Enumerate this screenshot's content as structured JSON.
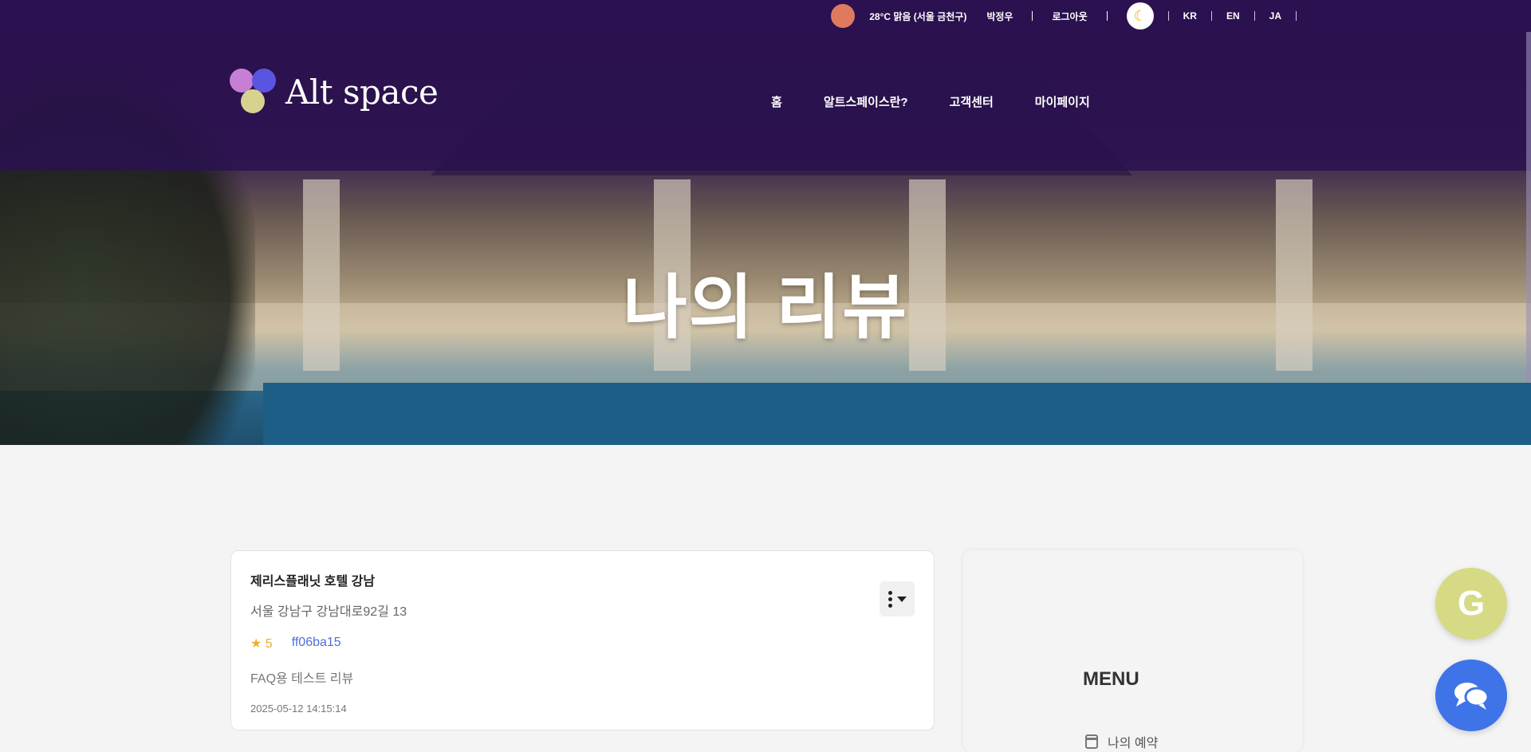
{
  "topbar": {
    "weather": "28°C 맑음 (서울 금천구)",
    "user_name": "박정우",
    "logout": "로그아웃",
    "languages": [
      "KR",
      "EN",
      "JA"
    ]
  },
  "header": {
    "logo_text": "Alt space",
    "nav": [
      "홈",
      "알트스페이스란?",
      "고객센터",
      "마이페이지"
    ]
  },
  "hero": {
    "title": "나의 리뷰"
  },
  "review": {
    "hotel_name": "제리스플래닛 호텔 강남",
    "address": "서울 강남구 강남대로92길 13",
    "rating_star": "★",
    "rating_value": "5",
    "code": "ff06ba15",
    "content": "FAQ용 테스트 리뷰",
    "date": "2025-05-12 14:15:14"
  },
  "side_menu": {
    "title": "MENU",
    "items": [
      "나의 예약"
    ]
  },
  "fab": {
    "g_label": "G"
  },
  "colors": {
    "topbar_bg": "#2b1150",
    "rating": "#f0ad2e",
    "code_link": "#4f6fd6",
    "fab_g": "#d6da84",
    "fab_chat": "#3f74e8"
  }
}
